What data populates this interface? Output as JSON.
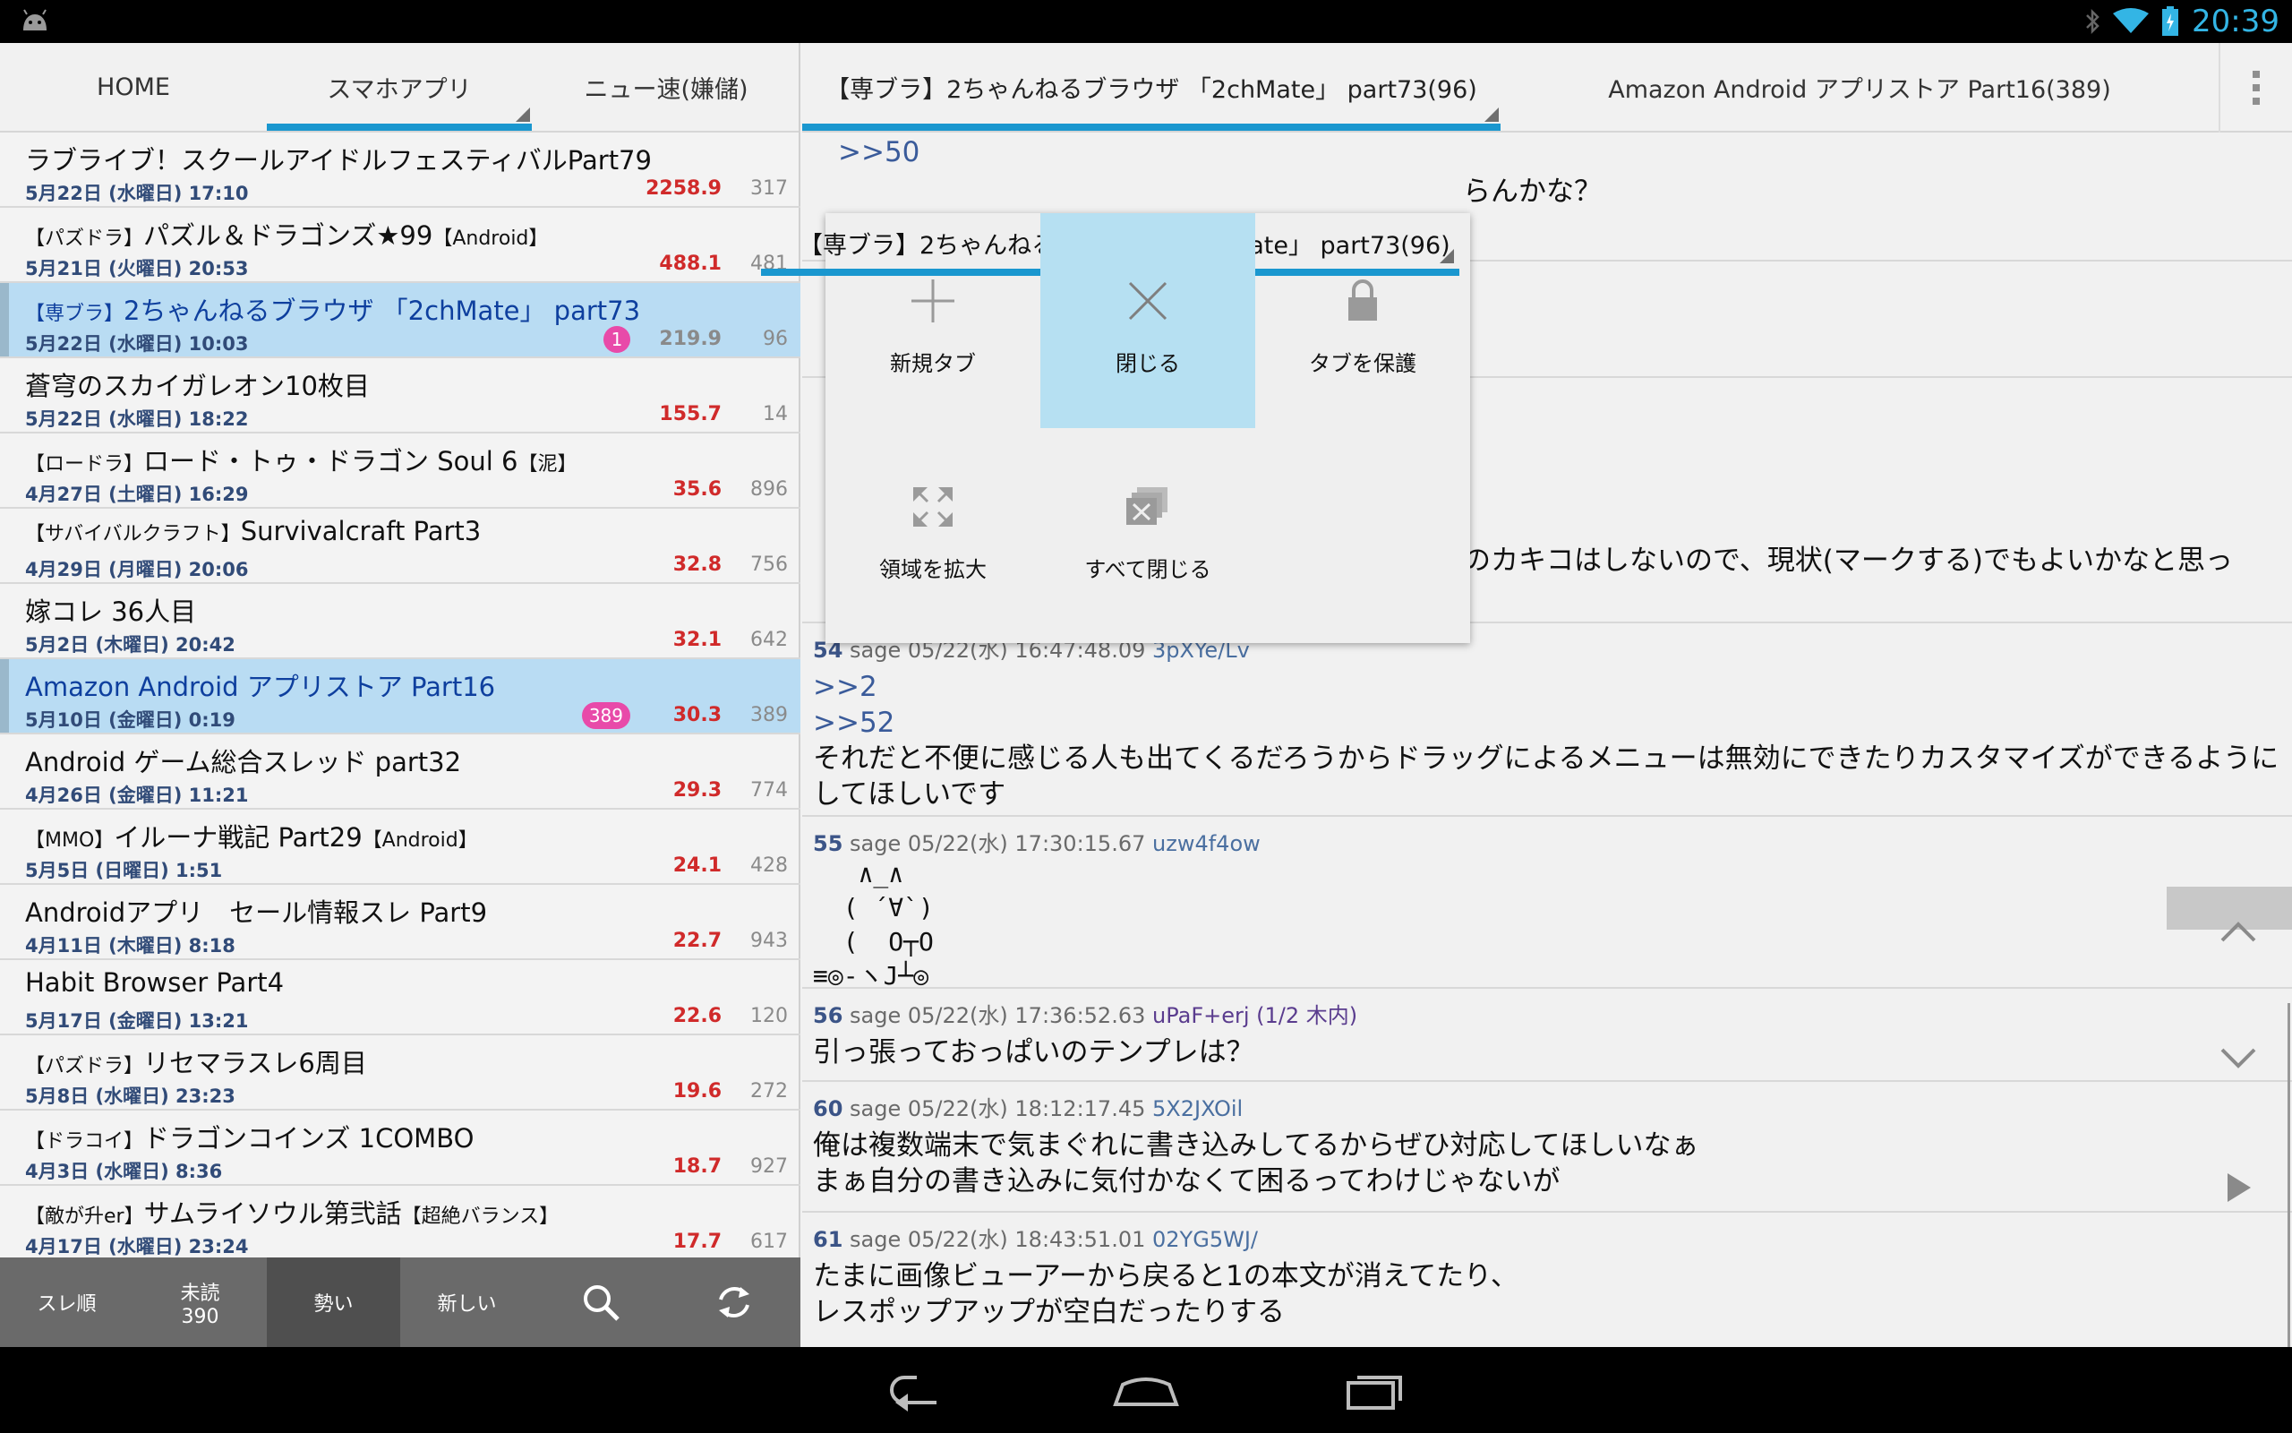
{
  "status": {
    "time": "20:39"
  },
  "left_tabs": [
    "HOME",
    "スマホアプリ",
    "ニュー速(嫌儲)"
  ],
  "threads": [
    {
      "title": "ラブライブ！スクールアイドルフェスティバルPart79",
      "date": "5月22日 (水曜日) 17:10",
      "ikioi": "2258.9",
      "count": "317"
    },
    {
      "tag_open": "【パズドラ】",
      "title": "パズル＆ドラゴンズ★99",
      "tag_close": "【Android】",
      "date": "5月21日 (火曜日) 20:53",
      "ikioi": "488.1",
      "count": "481"
    },
    {
      "tag_open": "【専ブラ】",
      "title": "2ちゃんねるブラウザ 「2chMate」 part73",
      "date": "5月22日 (水曜日) 10:03",
      "badge": "1",
      "ikioi": "219.9",
      "count": "96"
    },
    {
      "title": "蒼穹のスカイガレオン10枚目",
      "date": "5月22日 (水曜日) 18:22",
      "ikioi": "155.7",
      "count": "14"
    },
    {
      "tag_open": "【ロードラ】",
      "title": "ロード・トゥ・ドラゴン Soul 6",
      "tag_close": "【泥】",
      "date": "4月27日 (土曜日) 16:29",
      "ikioi": "35.6",
      "count": "896"
    },
    {
      "tag_open": "【サバイバルクラフト】",
      "title": "Survivalcraft Part3",
      "date": "4月29日 (月曜日) 20:06",
      "ikioi": "32.8",
      "count": "756"
    },
    {
      "title": "嫁コレ 36人目",
      "date": "5月2日 (木曜日) 20:42",
      "ikioi": "32.1",
      "count": "642"
    },
    {
      "title": "Amazon Android アプリストア Part16",
      "date": "5月10日 (金曜日) 0:19",
      "badge": "389",
      "ikioi": "30.3",
      "count": "389"
    },
    {
      "title": "Android ゲーム総合スレッド part32",
      "date": "4月26日 (金曜日) 11:21",
      "ikioi": "29.3",
      "count": "774"
    },
    {
      "tag_open": "【MMO】",
      "title": "イルーナ戦記 Part29",
      "tag_close": "【Android】",
      "date": "5月5日 (日曜日) 1:51",
      "ikioi": "24.1",
      "count": "428"
    },
    {
      "title": "Androidアプリ　セール情報スレ Part9",
      "date": "4月11日 (木曜日) 8:18",
      "ikioi": "22.7",
      "count": "943"
    },
    {
      "title": "Habit Browser Part4",
      "date": "5月17日 (金曜日) 13:21",
      "ikioi": "22.6",
      "count": "120"
    },
    {
      "tag_open": "【パズドラ】",
      "title": "リセマラスレ6周目",
      "date": "5月8日 (水曜日) 23:23",
      "ikioi": "19.6",
      "count": "272"
    },
    {
      "tag_open": "【ドラコイ】",
      "title": "ドラゴンコインズ 1COMBO",
      "date": "4月3日 (水曜日) 8:36",
      "ikioi": "18.7",
      "count": "927"
    },
    {
      "tag_open": "【敵が升er】",
      "title": "サムライソウル第弐話",
      "tag_close": "【超絶バランス】",
      "date": "4月17日 (水曜日) 23:24",
      "ikioi": "17.7",
      "count": "617"
    }
  ],
  "left_toolbar": {
    "sort_label": "スレ順",
    "unread_label": "未読",
    "unread_count": "390",
    "ikioi_label": "勢い",
    "new_label": "新しい"
  },
  "right_tabs": [
    "【専ブラ】2ちゃんねるブラウザ 「2chMate」 part73(96)",
    "Amazon Android アプリストア Part16(389)"
  ],
  "posts": {
    "p_top": {
      "anchor": ">>50",
      "fragment": "らんかな？"
    },
    "p_mid": {
      "fragment": "のカキコはしないので、現状(マークする)でもよいかなと思っ"
    },
    "p54": {
      "num": "54",
      "meta": "sage 05/22(水) 16:47:48.09",
      "id": "3pXYe/Lv",
      "anchor1": ">>2",
      "anchor2": ">>52",
      "text": "それだと不便に感じる人も出てくるだろうからドラッグによるメニューは無効にできたりカスタマイズができるようにしてほしいです"
    },
    "p55": {
      "num": "55",
      "meta": "sage 05/22(水) 17:30:15.67",
      "id": "uzw4f4ow",
      "aa": "   ∧_∧\n  ( ´∀`)\n  (  O┬O\n≡◎-ヽJ┴◎"
    },
    "p56": {
      "num": "56",
      "meta": "sage 05/22(水) 17:36:52.63",
      "id": "uPaF+erj (1/2 木内)",
      "text": "引っ張っておっぱいのテンプレは？"
    },
    "p60": {
      "num": "60",
      "meta": "sage 05/22(水) 18:12:17.45",
      "id": "5X2JXOil",
      "text": "俺は複数端末で気まぐれに書き込みしてるからぜひ対応してほしいなぁ\nまぁ自分の書き込みに気付かなくて困るってわけじゃないが"
    },
    "p61": {
      "num": "61",
      "meta": "sage 05/22(水) 18:43:51.01",
      "id": "02YG5WJ/",
      "text": "たまに画像ビューアーから戻ると1の本文が消えてたり、\nレスポップアップが空白だったりする"
    }
  },
  "popup": {
    "title": "【専ブラ】2ちゃんねるブラウザ 「2chMate」 part73(96)",
    "new_tab": "新規タブ",
    "close": "閉じる",
    "protect": "タブを保護",
    "expand": "領域を拡大",
    "close_all": "すべて閉じる"
  },
  "colors": {
    "accent": "#1a97cf",
    "selected_row": "#b9dcf3",
    "ikioi": "#d02a2a",
    "badge": "#e84aa9",
    "status_icons": "#33b5e5"
  },
  "icons": [
    "android-icon",
    "bluetooth-icon",
    "wifi-icon",
    "battery-icon",
    "search-icon",
    "refresh-icon",
    "plus-icon",
    "close-icon",
    "lock-icon",
    "expand-icon",
    "close-all-icon",
    "chevron-up-icon",
    "chevron-down-icon",
    "play-icon",
    "back-icon",
    "home-icon",
    "recents-icon",
    "overflow-menu-icon"
  ]
}
